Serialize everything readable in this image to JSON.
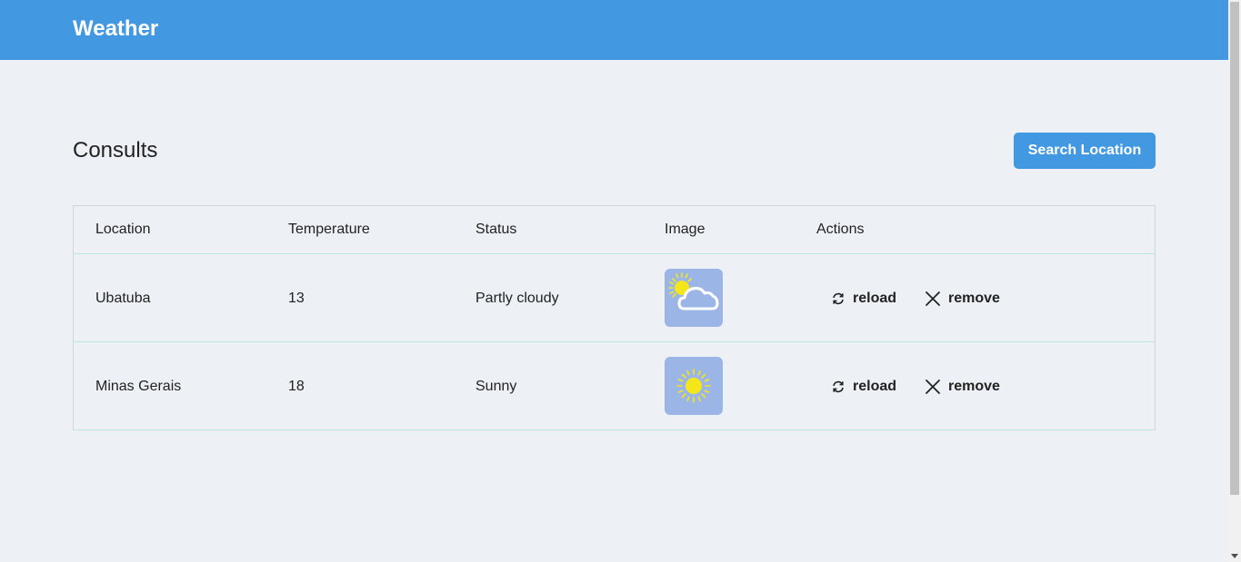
{
  "header": {
    "brand": "Weather"
  },
  "main": {
    "title": "Consults",
    "search_button": "Search Location"
  },
  "table": {
    "columns": [
      "Location",
      "Temperature",
      "Status",
      "Image",
      "Actions"
    ],
    "rows": [
      {
        "location": "Ubatuba",
        "temperature": "13",
        "status": "Partly cloudy",
        "icon": "partly-cloudy-icon"
      },
      {
        "location": "Minas Gerais",
        "temperature": "18",
        "status": "Sunny",
        "icon": "sunny-icon"
      }
    ],
    "actions": {
      "reload": "reload",
      "remove": "remove"
    }
  },
  "colors": {
    "accent": "#4299e1",
    "background": "#edf1f5",
    "image_bg": "#9bb6e6",
    "sun": "#f5e51b"
  }
}
